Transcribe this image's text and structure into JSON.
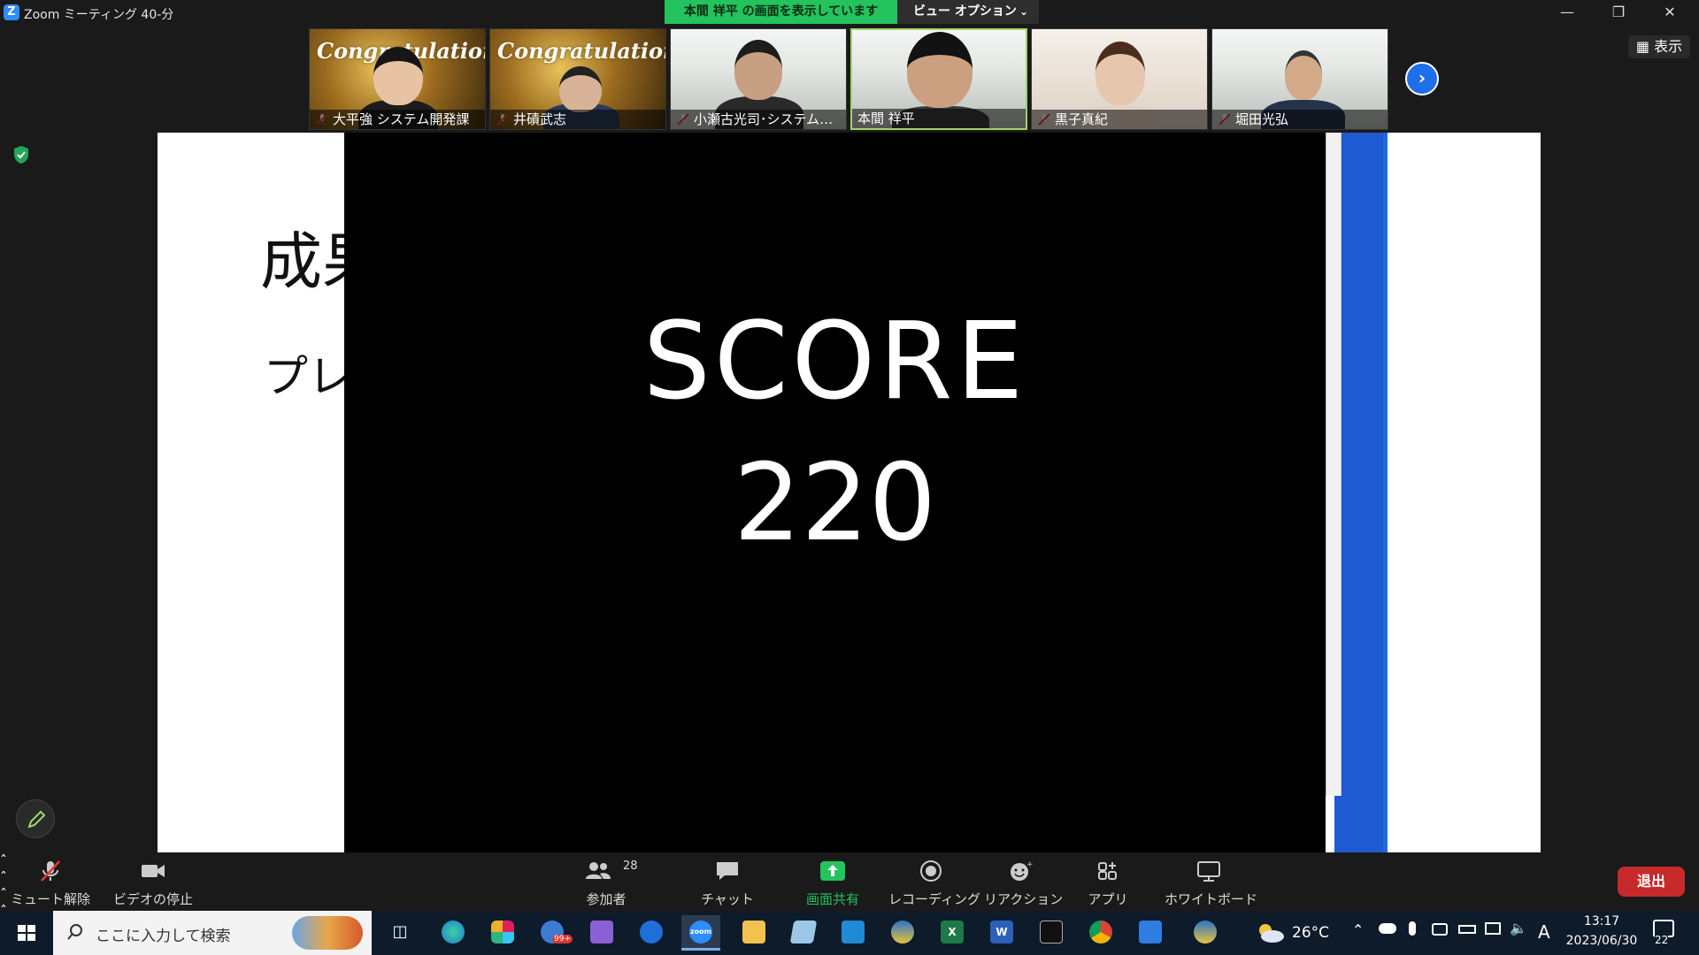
{
  "window": {
    "title": "Zoom ミーティング 40-分",
    "logo": "Z"
  },
  "sharing": {
    "banner": "本間 祥平 の画面を表示しています",
    "view_options": "ビュー オプション"
  },
  "participants": [
    {
      "name": "大平強 システム開発課",
      "muted": true,
      "banner": "Congratulations!"
    },
    {
      "name": "井磧武志",
      "muted": true,
      "banner": "Congratulations!"
    },
    {
      "name": "小瀬古光司･システム開…",
      "muted": true,
      "banner": ""
    },
    {
      "name": "本間 祥平",
      "muted": false,
      "banner": ""
    },
    {
      "name": "黒子真紀",
      "muted": true,
      "banner": ""
    },
    {
      "name": "堀田光弘",
      "muted": true,
      "banner": ""
    }
  ],
  "display_toggle": "表示",
  "shared_screen": {
    "slide_title_fragment": "成果",
    "slide_body_fragment": "プレ",
    "score_label": "SCORE",
    "score_value": "220"
  },
  "controls": {
    "mute": "ミュート解除",
    "video": "ビデオの停止",
    "participants": "参加者",
    "participants_count": "28",
    "chat": "チャット",
    "share": "画面共有",
    "record": "レコーディング",
    "reactions": "リアクション",
    "apps": "アプリ",
    "whiteboard": "ホワイトボード",
    "leave": "退出"
  },
  "taskbar": {
    "search_placeholder": "ここに入力して検索",
    "weather": "26°C",
    "ime": "A",
    "time": "13:17",
    "date": "2023/06/30",
    "notifications": "22",
    "mail_badge": "99+"
  },
  "colors": {
    "banner_green": "#23c35d",
    "leave_red": "#c72a2a",
    "accent_blue": "#1f6feb"
  }
}
